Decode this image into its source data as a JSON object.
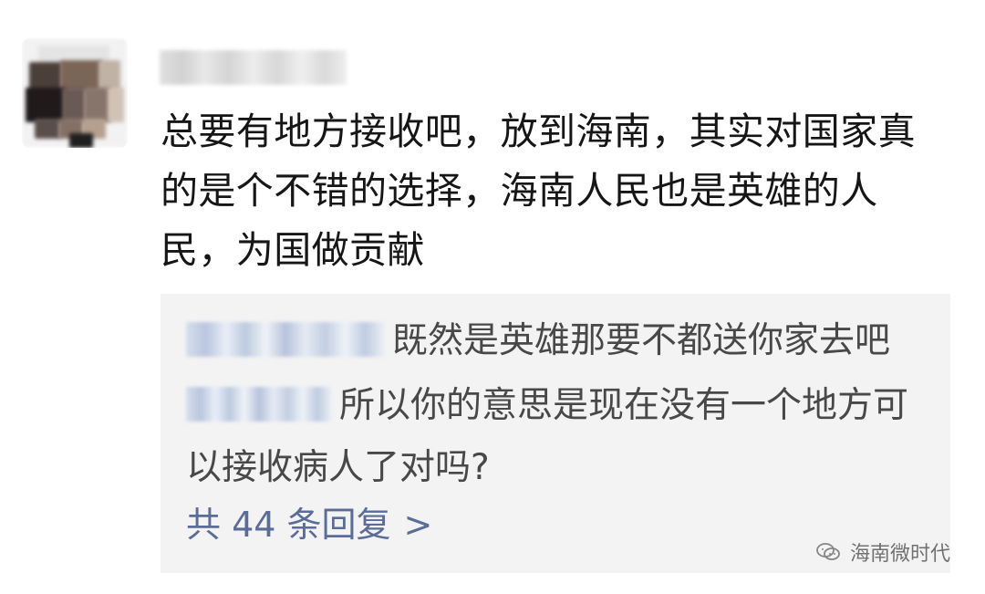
{
  "comment": {
    "text": "总要有地方接收吧，放到海南，其实对国家真的是个不错的选择，海南人民也是英雄的人民，为国做贡献"
  },
  "replies": [
    {
      "text": "既然是英雄那要不都送你家去吧"
    },
    {
      "text": "所以你的意思是现在没有一个地方可以接收病人了对吗?"
    }
  ],
  "more_replies": {
    "label": "共 44 条回复",
    "chevron": ">"
  },
  "watermark": {
    "text": "海南微时代",
    "icon": "wechat-icon"
  },
  "colors": {
    "main_text": "#161616",
    "reply_text": "#484848",
    "reply_bg": "#f3f3f3",
    "link": "#5b6c96"
  }
}
